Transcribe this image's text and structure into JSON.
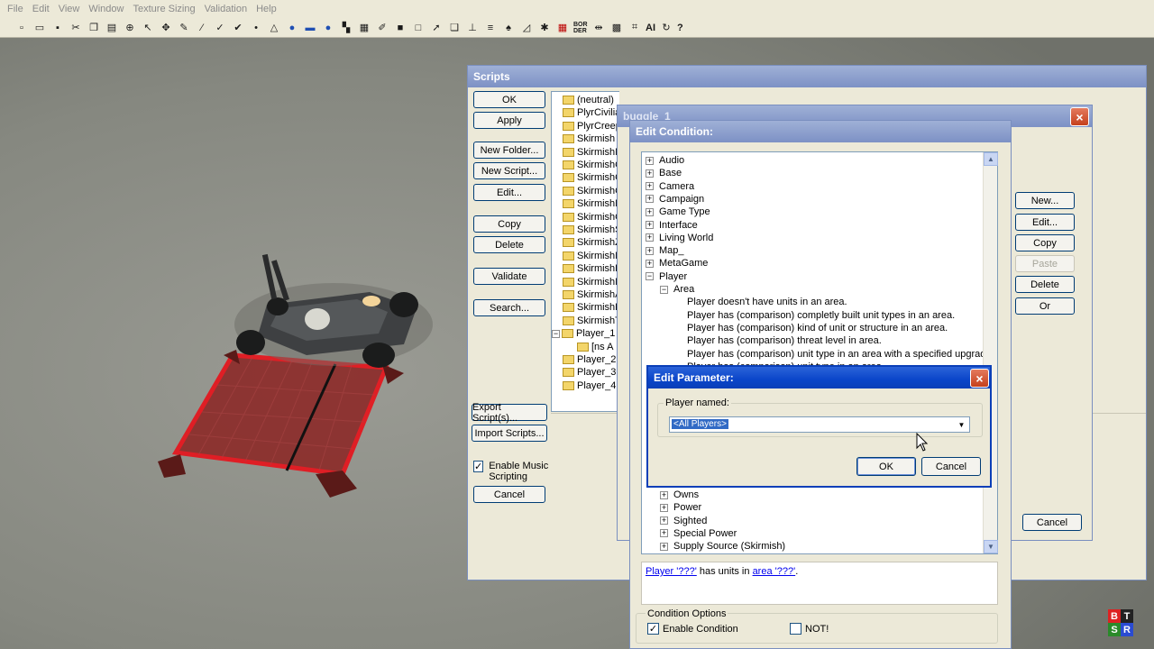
{
  "menu": [
    "File",
    "Edit",
    "View",
    "Window",
    "Texture Sizing",
    "Validation",
    "Help"
  ],
  "toolbar_icons": [
    "new-icon",
    "open-icon",
    "save-icon",
    "cut-icon",
    "copy-icon",
    "paste-icon",
    "zoom-icon",
    "select-icon",
    "move-icon",
    "paint-icon",
    "brush-icon",
    "check-icon",
    "check2-icon",
    "dot-icon",
    "pyramid-icon",
    "blob-icon",
    "road-icon",
    "blob2-icon",
    "checker-icon",
    "grid-icon",
    "pen-icon",
    "square-icon",
    "outline-icon",
    "arrow-icon",
    "pages-icon",
    "axis-icon",
    "lines-icon",
    "tree-icon",
    "ramp-icon",
    "star-icon",
    "wall-icon"
  ],
  "toolbar_text": {
    "border": "BOR DER",
    "ai": "AI",
    "help": "?"
  },
  "scripts": {
    "title": "Scripts",
    "buttons": {
      "ok": "OK",
      "apply": "Apply",
      "new_folder": "New Folder...",
      "new_script": "New Script...",
      "edit": "Edit...",
      "copy": "Copy",
      "delete": "Delete",
      "validate": "Validate",
      "search": "Search...",
      "export": "Export Script(s)...",
      "import": "Import Scripts...",
      "cancel": "Cancel"
    },
    "enable_music": {
      "label": "Enable Music Scripting",
      "checked": true
    },
    "folders": [
      "(neutral)",
      "PlyrCivilia",
      "PlyrCreep",
      "Skirmish",
      "SkirmishN",
      "SkirmishC",
      "SkirmishC",
      "SkirmishC",
      "SkirmishN",
      "SkirmishG",
      "SkirmishS",
      "SkirmishZ",
      "SkirmishN",
      "SkirmishB",
      "SkirmishM",
      "SkirmishA",
      "SkirmishR",
      "SkirmishT",
      "Player_1",
      "[ns A",
      "Player_2",
      "Player_3",
      "Player_4"
    ]
  },
  "script_window": {
    "title": "buggle_1",
    "buttons": {
      "new": "New...",
      "edit": "Edit...",
      "copy": "Copy",
      "paste": "Paste",
      "delete": "Delete",
      "or": "Or",
      "cancel": "Cancel"
    }
  },
  "edit_condition": {
    "title": "Edit Condition:",
    "tree_top": [
      "Audio",
      "Base",
      "Camera",
      "Campaign",
      "Game Type",
      "Interface",
      "Living World",
      "Map_",
      "MetaGame",
      "Player"
    ],
    "subfolder": "Area",
    "conditions": [
      "Player doesn't have units in an area.",
      "Player has (comparison) completly built unit types in an area.",
      "Player has (comparison) kind of unit or structure in an area.",
      "Player has (comparison) threat level in area.",
      "Player has (comparison) unit type in an area with a specified upgrade.",
      "Player has (comparison) unit type in an area."
    ],
    "tree_bottom": [
      "Owns",
      "Power",
      "Sighted",
      "Special Power",
      "Supply Source (Skirmish)"
    ],
    "description": {
      "link1": "Player '???'",
      "mid": " has units in ",
      "link2": "area '???'",
      "end": "."
    },
    "options_label": "Condition Options",
    "enable_condition": {
      "label": "Enable Condition",
      "checked": true
    },
    "not": {
      "label": "NOT!",
      "checked": false
    }
  },
  "edit_parameter": {
    "title": "Edit Parameter:",
    "group_label": "Player named:",
    "selected": "<All Players>",
    "ok": "OK",
    "cancel": "Cancel"
  },
  "corner_badge": [
    "B",
    "T",
    "S",
    "R"
  ],
  "colors": {
    "title_active": "#0a45c9",
    "title_inactive": "#7d91c5",
    "link": "#0000ee",
    "highlight": "#316ac5",
    "window_bg": "#ece9d8"
  }
}
